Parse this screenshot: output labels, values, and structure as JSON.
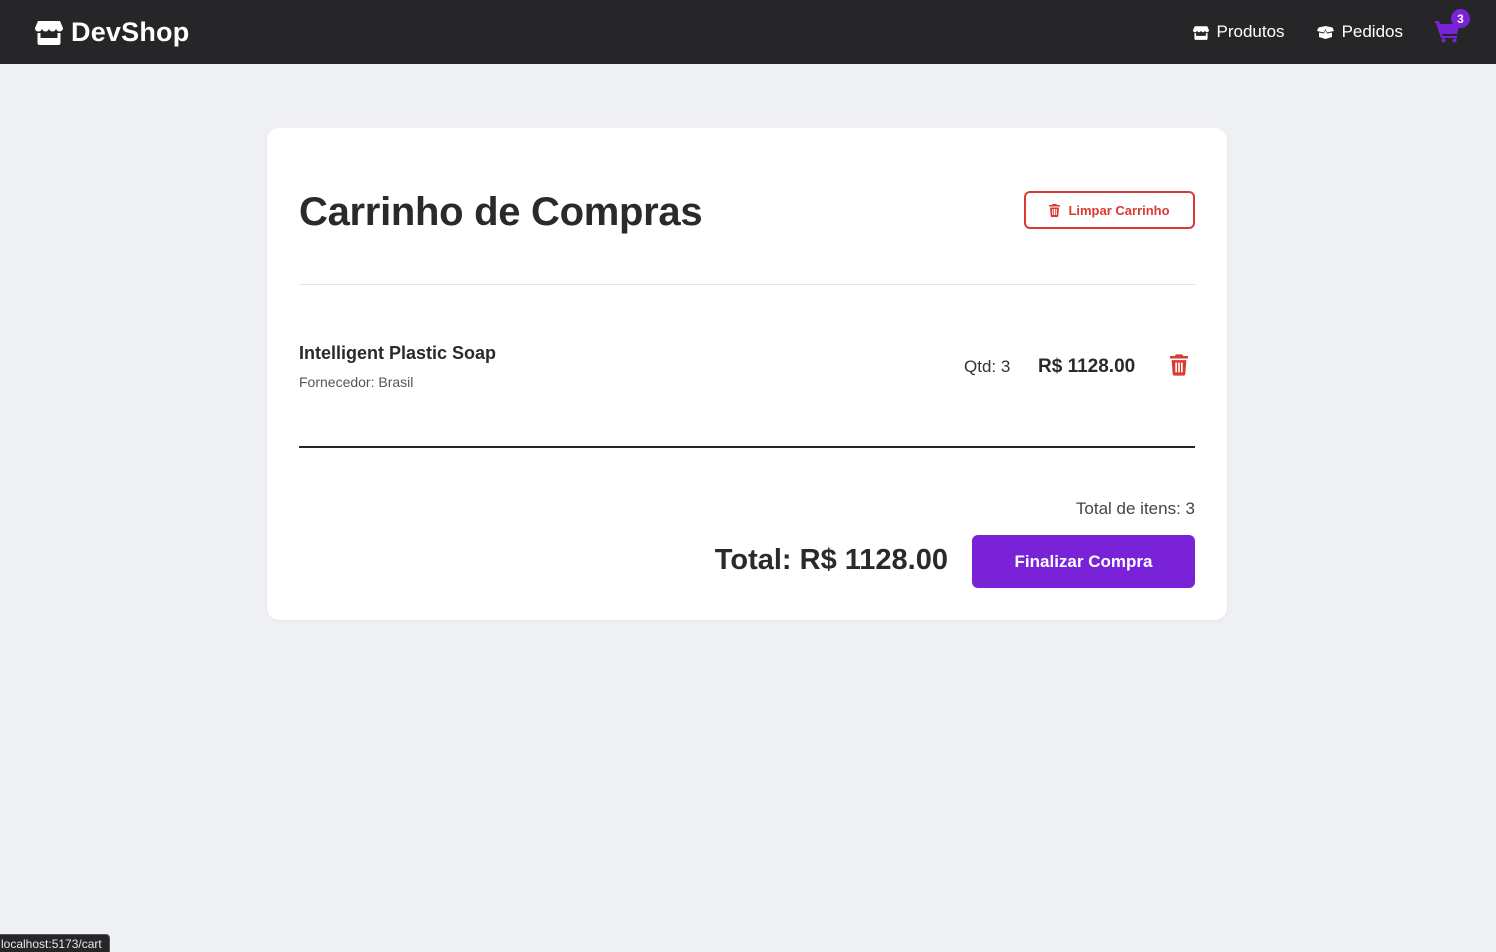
{
  "nav": {
    "brand": "DevShop",
    "links": [
      {
        "label": "Produtos",
        "icon": "store-icon"
      },
      {
        "label": "Pedidos",
        "icon": "box-icon"
      }
    ],
    "cart_icon": "shopping-cart-icon",
    "cart_count": "3"
  },
  "cart": {
    "title": "Carrinho de Compras",
    "clear_label": "Limpar Carrinho",
    "items": [
      {
        "name": "Intelligent Plastic Soap",
        "supplier": "Fornecedor: Brasil",
        "qty": "Qtd: 3",
        "price": "R$ 1128.00"
      }
    ],
    "total_items": "Total de itens: 3",
    "total": "Total: R$ 1128.00",
    "checkout_label": "Finalizar Compra"
  },
  "status_bar": {
    "url": "localhost:5173/cart"
  },
  "colors": {
    "navbar": "#262628",
    "accent": "#7a22d8",
    "danger": "#d93b32",
    "page_bg": "#eff0f4"
  }
}
